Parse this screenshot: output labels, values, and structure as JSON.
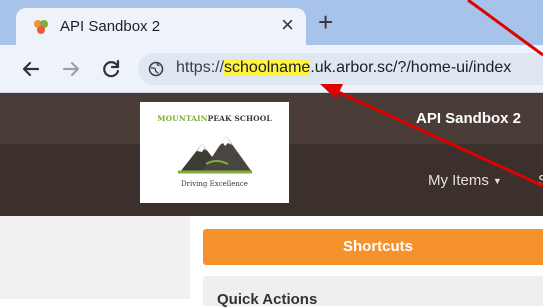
{
  "browser": {
    "tab_title": "API Sandbox 2",
    "tab_close": "×",
    "new_tab": "+",
    "url_protocol": "https://",
    "url_highlight": "schoolname",
    "url_rest": ".uk.arbor.sc/?/home-ui/index"
  },
  "app": {
    "title": "API Sandbox 2",
    "logo": {
      "name_part1": "MOUNTAIN",
      "name_part2": "PEAK SCHOOL",
      "tagline": "Driving Excellence"
    },
    "nav": {
      "my_items": "My Items",
      "next_item_cut": "S"
    },
    "shortcuts_label": "Shortcuts",
    "quick_actions_label": "Quick Actions"
  },
  "annotation_color": "#e00000",
  "highlight_color": "#fff43f",
  "accent_color": "#f6922e"
}
